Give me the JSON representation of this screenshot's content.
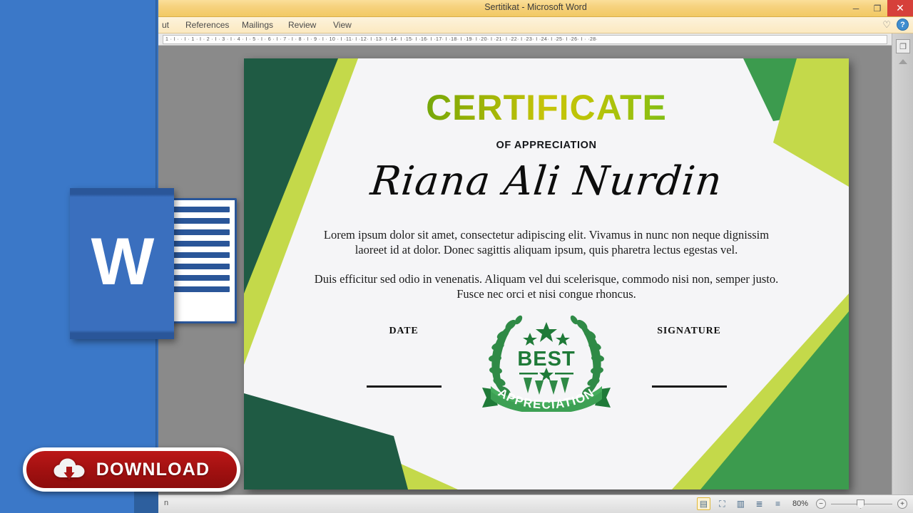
{
  "window": {
    "title": "Sertitikat  -  Microsoft Word",
    "minimize_label": "─",
    "restore_label": "❐",
    "close_label": "✕"
  },
  "ribbon": {
    "tabs": [
      {
        "label": "ut",
        "name": "tab-layout"
      },
      {
        "label": "References",
        "name": "tab-references"
      },
      {
        "label": "Mailings",
        "name": "tab-mailings"
      },
      {
        "label": "Review",
        "name": "tab-review"
      },
      {
        "label": "View",
        "name": "tab-view"
      }
    ],
    "heart_icon": "♡",
    "help_icon": "?"
  },
  "ruler": {
    "marks": "1 · I · · I · 1 · I · 2 · I · 3 · I · 4 · I · 5 · I · 6 · I · 7 · I · 8 · I · 9 · I · 10 · I ·11· I ·12· I ·13· I ·14· I ·15· I ·16· I ·17· I ·18· I ·19· I ·20· I ·21· I ·22· I ·23· I ·24· I ·25· I ·26· I · ·28·"
  },
  "certificate": {
    "title": "CERTIFICATE",
    "subtitle": "OF APPRECIATION",
    "recipient": "Riana Ali Nurdin",
    "paragraph_1": "Lorem ipsum dolor sit amet, consectetur adipiscing elit. Vivamus in nunc non neque dignissim laoreet id at dolor. Donec sagittis aliquam ipsum, quis pharetra lectus egestas vel.",
    "paragraph_2": "Duis efficitur sed odio in venenatis. Aliquam vel dui scelerisque, commodo nisi non, semper justo. Fusce nec orci et nisi congue rhoncus.",
    "date_label": "DATE",
    "signature_label": "SIGNATURE",
    "seal": {
      "top_text": "BEST",
      "ribbon_text": "APPRECIATION"
    },
    "colors": {
      "dark_green": "#1F5B44",
      "mid_green": "#3C9B4E",
      "lime": "#C4D94A",
      "page": "#F5F5F7",
      "title_gradient_start": "#1D7A2E",
      "title_gradient_mid": "#C6C40A",
      "title_gradient_end": "#35D131"
    }
  },
  "promo": {
    "app_logo_letter": "W",
    "download_label": "DOWNLOAD",
    "download_color": "#A81414"
  },
  "status_bar": {
    "left_text": "n",
    "zoom_level": "80%",
    "zoom_out_label": "−",
    "zoom_in_label": "+",
    "view_buttons": [
      {
        "name": "view-print-layout",
        "glyph": "▤",
        "active": true
      },
      {
        "name": "view-read-mode",
        "glyph": "⛶",
        "active": false
      },
      {
        "name": "view-web-layout",
        "glyph": "▥",
        "active": false
      },
      {
        "name": "view-outline",
        "glyph": "≣",
        "active": false
      },
      {
        "name": "view-draft",
        "glyph": "≡",
        "active": false
      }
    ]
  },
  "side_panel": {
    "icon": "❐"
  }
}
